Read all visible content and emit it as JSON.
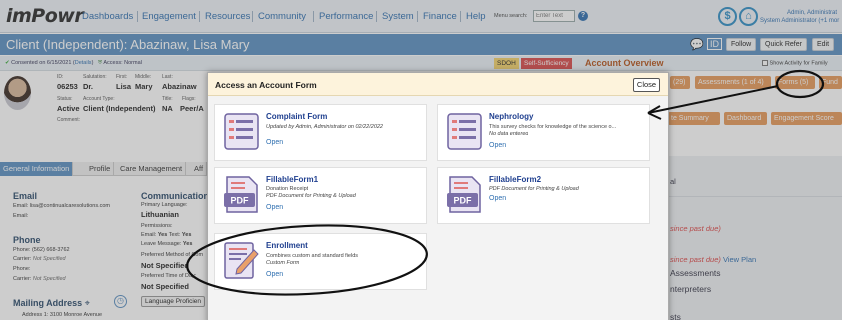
{
  "app": {
    "logo": "imPowr"
  },
  "nav": {
    "items": [
      "Dashboards",
      "Engagement",
      "Resources",
      "Community",
      "Performance",
      "System",
      "Finance",
      "Help"
    ],
    "menu_search_label": "Menu search:",
    "menu_search_placeholder": "Enter Text",
    "help_icon": "question-circle-icon"
  },
  "user": {
    "name": "Admin, Administrat",
    "role": "System Administrator (+1 mor"
  },
  "client": {
    "title": "Client (Independent): Abazinaw, Lisa Mary",
    "buttons": {
      "follow": "Follow",
      "quick_refer": "Quick Refer",
      "edit": "Edit"
    }
  },
  "consent": {
    "text": "Consented on 6/15/2021 (",
    "details": "Details",
    "access": "Access: Normal"
  },
  "badges": {
    "sdoh": "SDOH",
    "self_sufficiency": "Self-Sufficiency",
    "account_overview": "Account Overview"
  },
  "show_activity": "Show Activity for Family",
  "orange_tabs": {
    "count_29": "(29)",
    "assessments": "Assessments (1 of 4)",
    "forms": "Forms (5)",
    "fund": "Fund",
    "summary": "te Summary",
    "dashboard": "Dashboard",
    "engagement_score": "Engagement Score"
  },
  "profile": {
    "labels": {
      "id": "ID:",
      "salutation": "Salutation:",
      "first": "First:",
      "middle": "Middle:",
      "last": "Last:",
      "status": "Status:",
      "account_type": "Account Type:",
      "title": "Title:",
      "flags": "Flags:",
      "comment": "Comment:"
    },
    "values": {
      "id": "06253",
      "salutation": "Dr.",
      "first": "Lisa",
      "middle": "Mary",
      "last": "Abazinaw",
      "status": "Active",
      "account_type": "Client (Independent)",
      "title": "NA",
      "flags": "Peer/A"
    }
  },
  "subtabs": [
    "General Information",
    "Profile",
    "Care Management",
    "Aff"
  ],
  "email": {
    "heading": "Email",
    "line1_label": "Email:",
    "line1_value": "lisa@continualcaresolutions.com",
    "line2_label": "Email:"
  },
  "phone": {
    "heading": "Phone",
    "phone1_label": "Phone:",
    "phone1_value": "(562) 668-3762",
    "carrier1": "Carrier:",
    "carrier1_value": "Not Specified",
    "phone2_label": "Phone:",
    "carrier2": "Carrier:",
    "carrier2_value": "Not Specified"
  },
  "mailing": {
    "heading": "Mailing Address",
    "address_label": "Address 1:",
    "address_value": "3100 Monroe Avenue"
  },
  "communication": {
    "heading": "Communication",
    "primary_language_label": "Primary Language:",
    "primary_language": "Lithuanian",
    "permissions_label": "Permissions:",
    "email_label": "Email:",
    "email_yes": "Yes",
    "text_label": "Text:",
    "text_yes": "Yes",
    "leave_message_label": "Leave Message:",
    "leave_message_value": "Yes",
    "preferred_method_label": "Preferred Method of Com",
    "preferred_method_value": "Not Specified",
    "preferred_time_label": "Preferred Time of Day:",
    "preferred_time_value": "Not Specified",
    "language_btn": "Language Proficien"
  },
  "right_bg": {
    "line_al": "al",
    "past_due1": "since past due)",
    "past_due2": "since past due)",
    "view_plan": "View Plan",
    "assessments": "Assessments",
    "interpreters": "nterpreters",
    "bottom": "sts"
  },
  "modal": {
    "title": "Access an Account Form",
    "close": "Close",
    "open_label": "Open",
    "forms": [
      {
        "title": "Complaint Form",
        "desc": "Updated by Admin, Administrator on 02/22/2022",
        "desc2": "",
        "icon": "form-document-icon"
      },
      {
        "title": "Nephrology",
        "desc": "This survey checks for knowledge of the science o...",
        "desc2": "No data entered",
        "icon": "form-document-icon"
      },
      {
        "title": "FillableForm1",
        "desc": "Donation Receipt",
        "desc2": "PDF Document for Printing & Upload",
        "icon": "pdf-icon",
        "icon_text": "PDF"
      },
      {
        "title": "FillableForm2",
        "desc": "PDF Document for Printing & Upload",
        "desc2": "",
        "icon": "pdf-icon",
        "icon_text": "PDF"
      },
      {
        "title": "Enrollment",
        "desc": "Combines custom and standard fields",
        "desc2": "Custom Form",
        "icon": "custom-form-icon"
      }
    ]
  },
  "colors": {
    "nav_link": "#2f6fb0",
    "client_bar": "#5b90c2",
    "orange_tab": "#e79a5a",
    "form_title": "#1f3f8f",
    "modal_header": "#fdf3dc",
    "pdf_purple": "#7b6fa8",
    "annotation_ink": "#111111"
  }
}
